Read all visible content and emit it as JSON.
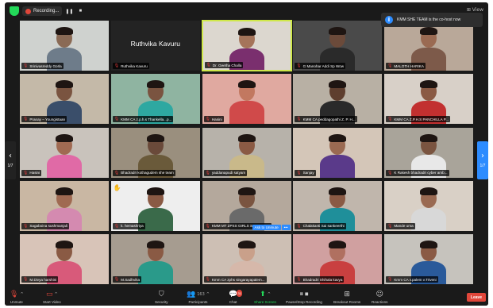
{
  "topbar": {
    "recording_label": "Recording...",
    "pause_icon": "pause-icon",
    "stop_icon": "stop-icon",
    "view_label": "⊞ View"
  },
  "notification": {
    "text": "KMM SHE TEAM is the co-host now"
  },
  "pagination": {
    "left_page": "1/7",
    "right_page": "1/7"
  },
  "participants": [
    {
      "name": "Srinivasreddy Gorla",
      "bg": "#cfd2cf",
      "skin": "#8a6a55",
      "shirt": "#6e7c8a"
    },
    {
      "name": "Ruthvika Kavuru",
      "name_only": true
    },
    {
      "name": "Dr. Geetha Challa",
      "bg": "#dcd7cf",
      "skin": "#a5745a",
      "shirt": "#7a2f6e",
      "active": true
    },
    {
      "name": "G Manohar Addi Sp Wow",
      "bg": "#4a4a4a",
      "skin": "#6b4a3a",
      "shirt": "#2a2a2a"
    },
    {
      "name": "MALOTH HARIKA",
      "bg": "#b9a899",
      "skin": "#9a6a52",
      "shirt": "#7d5a4a"
    },
    {
      "name": "Pranay – Youngistaan",
      "bg": "#c4b9a8",
      "skin": "#7a5440",
      "shirt": "#3a4e6a"
    },
    {
      "name": "KMM CA z.p.h.s Thankella...p...",
      "bg": "#8fb4a1",
      "skin": "#7a5440",
      "shirt": "#2ea8a1"
    },
    {
      "name": "Hasini",
      "bg": "#e0a9a0",
      "skin": "#c27860",
      "shirt": "#d04a4a"
    },
    {
      "name": "KMM CA peddagopathi Z. P. H...",
      "bg": "#b8b0a4",
      "skin": "#5e3e2e",
      "shirt": "#2a2a2a"
    },
    {
      "name": "KMM CA Z.P.H.S PANCHILLA P...",
      "bg": "#d8d0c8",
      "skin": "#8a5a44",
      "shirt": "#c23030"
    },
    {
      "name": "Hasini",
      "bg": "#c9c3bc",
      "skin": "#a06a52",
      "shirt": "#e06aa6"
    },
    {
      "name": "Bhadradri kothagudem she team",
      "bg": "#9a8f7e",
      "skin": "#6a4a3a",
      "shirt": "#6a5a3a"
    },
    {
      "name": "yaddanapudi satyam",
      "bg": "#b7b2aa",
      "skin": "#8a5a44",
      "shirt": "#c9b98a"
    },
    {
      "name": "Sanjay",
      "bg": "#d4c6b8",
      "skin": "#9a6a52",
      "shirt": "#5a3a8a"
    },
    {
      "name": "K Rakesh bhadradri cyber amb...",
      "bg": "#a9a49a",
      "skin": "#7a5440",
      "shirt": "#e8e8e8"
    },
    {
      "name": "Sagaboina sushmanjali",
      "bg": "#c9b7a3",
      "skin": "#a06a52",
      "shirt": "#d48ab0"
    },
    {
      "name": "k. hemashriya",
      "bg": "#eeeeee",
      "skin": "#8a5a44",
      "shirt": "#3a6a4a",
      "hand_raised": true
    },
    {
      "name": "KMM MT ZPSS GIRLS SATHUPA...",
      "bg": "#b4a89c",
      "skin": "#7a5440",
      "shirt": "#6a6a6a",
      "ask_unmute": true
    },
    {
      "name": "Chalakanti Sai sankeerthi",
      "bg": "#c0b6ac",
      "skin": "#8a5a44",
      "shirt": "#1f8f9a"
    },
    {
      "name": "Mande uma",
      "bg": "#d9d0c6",
      "skin": "#9a6a52",
      "shirt": "#d8d8d8"
    },
    {
      "name": "M.Divya harshini",
      "bg": "#d8c4b8",
      "skin": "#8a5a44",
      "shirt": "#d85a7a"
    },
    {
      "name": "M.Sadhvika",
      "bg": "#a69c90",
      "skin": "#8a5a44",
      "shirt": "#2a9a8a"
    },
    {
      "name": "Kmm CA zphs singarayapalem...",
      "bg": "#cdbfb4",
      "skin": "#c9a08a",
      "shirt": "#d6b8aa"
    },
    {
      "name": "Bhadradri Shihala kavya",
      "bg": "#d0a0a0",
      "skin": "#b07060",
      "shirt": "#c94040"
    },
    {
      "name": "Kmm CA v.palem v.Triveni",
      "bg": "#c6c3bd",
      "skin": "#8a5a44",
      "shirt": "#2a5a9a"
    }
  ],
  "ask_unmute": {
    "label": "Ask to Unmute",
    "more": "•••"
  },
  "toolbar": {
    "unmute": "Unmute",
    "start_video": "Start Video",
    "security": "Security",
    "participants": "Participants",
    "participants_count": "163",
    "chat": "Chat",
    "chat_badge": "31",
    "share_screen": "Share Screen",
    "pause_stop_recording": "Pause/Stop Recording",
    "breakout_rooms": "Breakout Rooms",
    "reactions": "Reactions",
    "leave": "Leave"
  },
  "icons": {
    "mic_off": "mic-off-icon",
    "video_off": "video-off-icon",
    "shield": "shield-icon",
    "people": "people-icon",
    "chat": "chat-icon",
    "share": "share-screen-icon",
    "breakout": "breakout-icon",
    "reactions": "smiley-icon"
  },
  "colors": {
    "active_speaker_border": "#cfe84a",
    "accent_blue": "#2d8cff",
    "leave_red": "#e0463a",
    "share_green": "#23d959"
  }
}
